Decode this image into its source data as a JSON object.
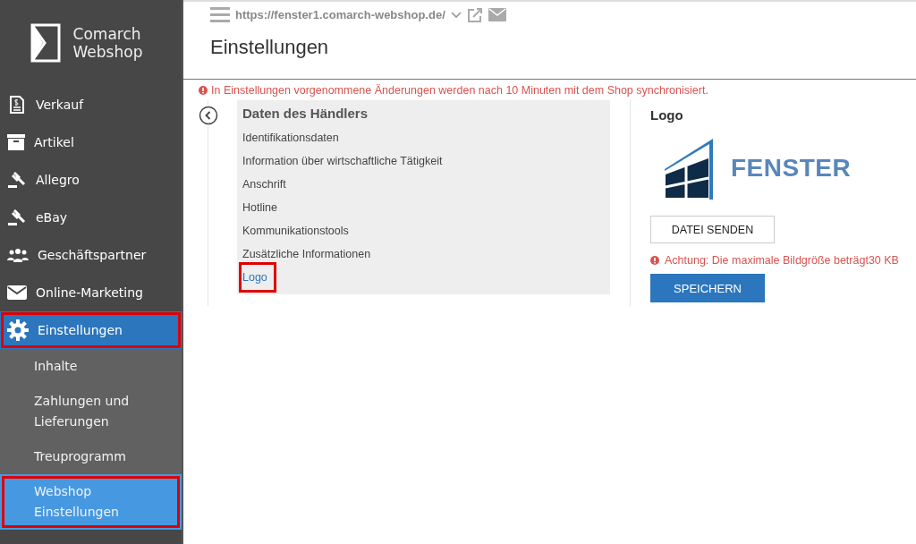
{
  "sidebar": {
    "brand": [
      "Comarch",
      "Webshop"
    ],
    "items": [
      {
        "label": "Verkauf",
        "selected": false,
        "annotated": false
      },
      {
        "label": "Artikel",
        "selected": false,
        "annotated": false
      },
      {
        "label": "Allegro",
        "selected": false,
        "annotated": false
      },
      {
        "label": "eBay",
        "selected": false,
        "annotated": false
      },
      {
        "label": "Geschäftspartner",
        "selected": false,
        "annotated": false
      },
      {
        "label": "Online-Marketing",
        "selected": false,
        "annotated": false
      },
      {
        "label": "Einstellungen",
        "selected": true,
        "annotated": true
      }
    ],
    "subitems": [
      {
        "label": "Inhalte",
        "selected": false,
        "annotated": false
      },
      {
        "label": "Zahlungen und Lieferungen",
        "selected": false,
        "annotated": false
      },
      {
        "label": "Treuprogramm",
        "selected": false,
        "annotated": false
      },
      {
        "label": "Webshop Einstellungen",
        "selected": true,
        "annotated": true
      }
    ]
  },
  "topbar": {
    "url": "https://fenster1.comarch-webshop.de/"
  },
  "page_title": "Einstellungen",
  "notice": "In Einstellungen vorgenommene Änderungen werden nach 10 Minuten mit dem Shop synchronisiert.",
  "section_nav": {
    "title": "Daten des Händlers",
    "items": [
      {
        "label": "Identifikationsdaten",
        "selected": false,
        "annotated": false
      },
      {
        "label": "Information über wirtschaftliche Tätigkeit",
        "selected": false,
        "annotated": false
      },
      {
        "label": "Anschrift",
        "selected": false,
        "annotated": false
      },
      {
        "label": "Hotline",
        "selected": false,
        "annotated": false
      },
      {
        "label": "Kommunikationstools",
        "selected": false,
        "annotated": false
      },
      {
        "label": "Zusätzliche Informationen",
        "selected": false,
        "annotated": false
      },
      {
        "label": "Logo",
        "selected": true,
        "annotated": true
      }
    ]
  },
  "logo_panel": {
    "title": "Logo",
    "logo_text": "FENSTER",
    "upload_button": "DATEI SENDEN",
    "warning": "Achtung: Die maximale Bildgröße beträgt30 KB",
    "save_button": "SPEICHERN"
  }
}
